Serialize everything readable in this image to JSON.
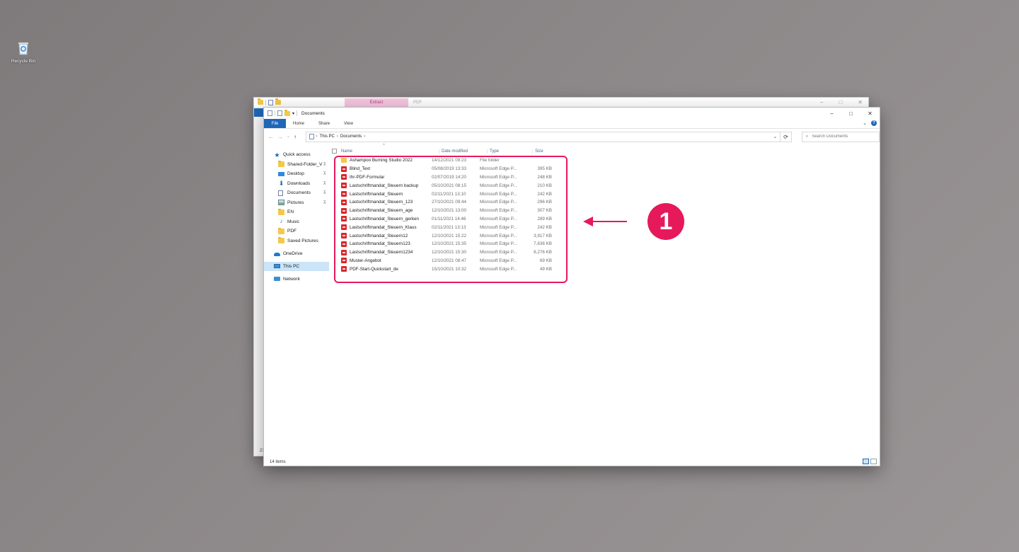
{
  "desktop": {
    "recycle_bin_label": "Recycle Bin"
  },
  "back_window": {
    "tab_extract": "Extract",
    "tab_pdf": "PDF",
    "status": "21"
  },
  "window": {
    "title": "Documents",
    "ribbon_tabs": [
      "File",
      "Home",
      "Share",
      "View"
    ],
    "breadcrumb": [
      "This PC",
      "Documents"
    ],
    "search_placeholder": "Search Documents",
    "columns": {
      "name": "Name",
      "date": "Date modified",
      "type": "Type",
      "size": "Size"
    },
    "sidebar": {
      "quick_access": "Quick access",
      "items": [
        {
          "label": "Shared-Folder_V",
          "icon": "folder-icon",
          "pinned": true
        },
        {
          "label": "Desktop",
          "icon": "desktop-icon",
          "pinned": true
        },
        {
          "label": "Downloads",
          "icon": "download-icon",
          "pinned": true
        },
        {
          "label": "Documents",
          "icon": "documents-icon",
          "pinned": true
        },
        {
          "label": "Pictures",
          "icon": "pictures-icon",
          "pinned": true
        },
        {
          "label": "EN",
          "icon": "folder-icon",
          "pinned": false
        },
        {
          "label": "Music",
          "icon": "music-icon",
          "pinned": false
        },
        {
          "label": "PDF",
          "icon": "folder-icon",
          "pinned": false
        },
        {
          "label": "Saved Pictures",
          "icon": "folder-icon",
          "pinned": false
        }
      ],
      "onedrive": "OneDrive",
      "this_pc": "This PC",
      "network": "Network"
    },
    "files": [
      {
        "name": "Ashampoo Burning Studio 2022",
        "date": "14/12/2021 09:23",
        "type": "File folder",
        "size": "",
        "kind": "folder"
      },
      {
        "name": "Blind_Text",
        "date": "05/08/2019 13:33",
        "type": "Microsoft Edge P...",
        "size": "395 KB",
        "kind": "pdf"
      },
      {
        "name": "Ihr-PDF-Formular",
        "date": "02/07/2019 14:20",
        "type": "Microsoft Edge P...",
        "size": "248 KB",
        "kind": "pdf"
      },
      {
        "name": "Lastschriftmandat_Steuern backup",
        "date": "05/10/2021 08:15",
        "type": "Microsoft Edge P...",
        "size": "210 KB",
        "kind": "pdf"
      },
      {
        "name": "Lastschriftmandat_Steuern",
        "date": "02/11/2021 13:10",
        "type": "Microsoft Edge P...",
        "size": "242 KB",
        "kind": "pdf"
      },
      {
        "name": "Lastschriftmandat_Steuern_123",
        "date": "27/10/2021 09:44",
        "type": "Microsoft Edge P...",
        "size": "296 KB",
        "kind": "pdf"
      },
      {
        "name": "Lastschriftmandat_Steuern_age",
        "date": "12/10/2021 13:00",
        "type": "Microsoft Edge P...",
        "size": "307 KB",
        "kind": "pdf"
      },
      {
        "name": "Lastschriftmandat_Steuern_gerken",
        "date": "01/11/2021 14:46",
        "type": "Microsoft Edge P...",
        "size": "289 KB",
        "kind": "pdf"
      },
      {
        "name": "Lastschriftmandat_Steuern_Klaus",
        "date": "02/11/2021 13:13",
        "type": "Microsoft Edge P...",
        "size": "242 KB",
        "kind": "pdf"
      },
      {
        "name": "Lastschriftmandat_Steuern12",
        "date": "12/10/2021 15:22",
        "type": "Microsoft Edge P...",
        "size": "3,917 KB",
        "kind": "pdf"
      },
      {
        "name": "Lastschriftmandat_Steuern123",
        "date": "12/10/2021 15:35",
        "type": "Microsoft Edge P...",
        "size": "7,636 KB",
        "kind": "pdf"
      },
      {
        "name": "Lastschriftmandat_Steuern1234",
        "date": "12/10/2021 15:30",
        "type": "Microsoft Edge P...",
        "size": "8,276 KB",
        "kind": "pdf"
      },
      {
        "name": "Muster-Angebot",
        "date": "12/10/2021 08:47",
        "type": "Microsoft Edge P...",
        "size": "69 KB",
        "kind": "pdf"
      },
      {
        "name": "PDF-Start-Quickstart_de",
        "date": "15/10/2021 10:32",
        "type": "Microsoft Edge P...",
        "size": "49 KB",
        "kind": "pdf"
      }
    ],
    "status": "14 items"
  },
  "annotation": {
    "badge": "1",
    "color": "#e6195b"
  }
}
